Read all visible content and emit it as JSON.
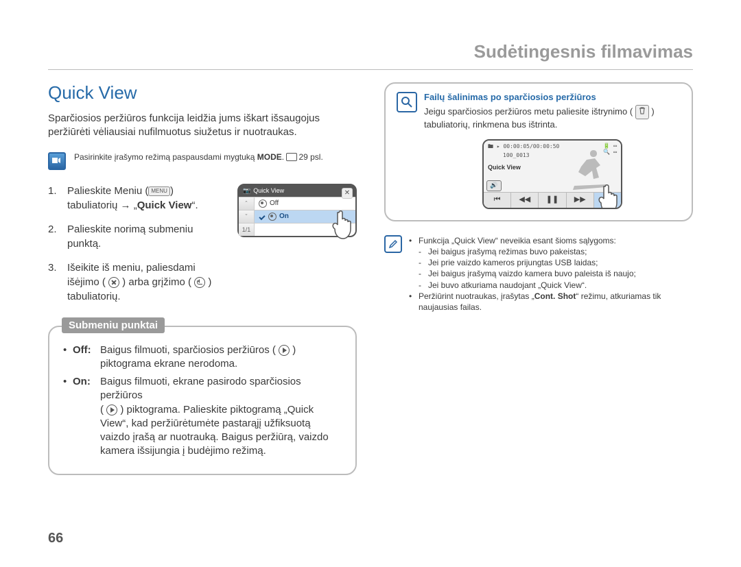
{
  "header": {
    "title": "Sudėtingesnis filmavimas"
  },
  "page_number": "66",
  "left": {
    "section_title": "Quick View",
    "intro": "Sparčiosios peržiūros funkcija leidžia jums iškart išsaugojus peržiūrėti vėliausiai nufilmuotus siužetus ir nuotraukas.",
    "mode_note_pre": "Pasirinkite įrašymo režimą paspausdami mygtuką ",
    "mode_note_btn": "MODE",
    "mode_note_post": ". ",
    "mode_note_page": "29 psl.",
    "steps": {
      "s1a": "Palieskite Meniu (",
      "s1btn": "MENU",
      "s1b": ") tabuliatorių → „",
      "s1bold": "Quick View",
      "s1c": "“.",
      "s2": "Palieskite norimą submeniu punktą.",
      "s3a": "Išeikite iš meniu, paliesdami išėjimo ( ",
      "s3b": " ) arba grįžimo ( ",
      "s3c": " ) tabuliatorių."
    },
    "lcd": {
      "title": "Quick View",
      "row_off": "Off",
      "row_on": "On",
      "page": "1/1"
    },
    "sub_title": "Submeniu punktai",
    "sub": {
      "off_label": "Off:",
      "off_text": " Baigus filmuoti, sparčiosios peržiūros ( ",
      "off_text2": " ) piktograma ekrane nerodoma.",
      "on_label": "On:",
      "on_text1": " Baigus filmuoti, ekrane pasirodo sparčiosios peržiūros",
      "on_text2": "( ",
      "on_text3": " ) piktograma. Palieskite piktogramą „Quick View“, kad peržiūrėtumėte pastarąjį užfiksuotą vaizdo įrašą ar nuotrauką. Baigus peržiūrą, vaizdo kamera išsijungia į budėjimo režimą."
    }
  },
  "right": {
    "mag_title": "Failų šalinimas po sparčiosios peržiūros",
    "mag_body_a": "Jeigu sparčiosios peržiūros metu paliesite ištrynimo ( ",
    "mag_body_b": " ) tabuliatorių, rinkmena bus ištrinta.",
    "lcd2": {
      "time": "00:00:05/00:00:50",
      "folder": "100_0013",
      "qv": "Quick View"
    },
    "note": {
      "l1": "Funkcija „Quick View“ neveikia esant šioms sąlygoms:",
      "d1": "Jei baigus įrašymą režimas buvo pakeistas;",
      "d2": "Jei prie vaizdo kameros prijungtas USB laidas;",
      "d3": "Jei baigus įrašymą vaizdo kamera buvo paleista iš naujo;",
      "d4": "Jei buvo atkuriama naudojant „Quick View“.",
      "l2a": "Peržiūrint nuotraukas, įrašytas „",
      "l2b": "Cont. Shot",
      "l2c": "“ režimu, atkuriamas tik naujausias failas."
    }
  }
}
